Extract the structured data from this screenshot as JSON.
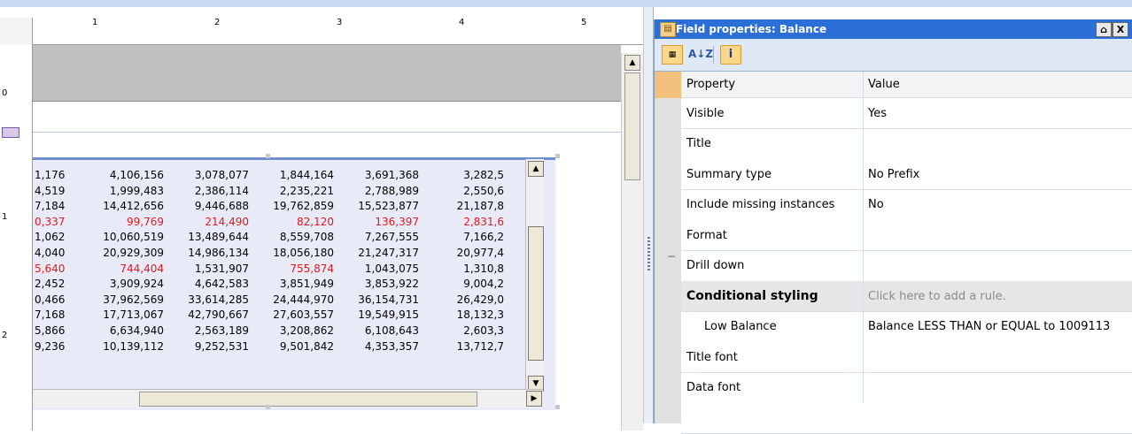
{
  "ruler": {
    "top_marks": [
      "1",
      "2",
      "3",
      "4",
      "5"
    ],
    "left_marks": [
      "0",
      "1",
      "2"
    ]
  },
  "grid": {
    "rows": [
      {
        "cells": [
          "1,176",
          "4,106,156",
          "3,078,077",
          "1,844,164",
          "3,691,368",
          "3,282,5"
        ],
        "red": false
      },
      {
        "cells": [
          "4,519",
          "1,999,483",
          "2,386,114",
          "2,235,221",
          "2,788,989",
          "2,550,6"
        ],
        "red": false
      },
      {
        "cells": [
          "7,184",
          "14,412,656",
          "9,446,688",
          "19,762,859",
          "15,523,877",
          "21,187,8"
        ],
        "red": false
      },
      {
        "cells": [
          "0,337",
          "99,769",
          "214,490",
          "82,120",
          "136,397",
          "2,831,6"
        ],
        "red": true
      },
      {
        "cells": [
          "1,062",
          "10,060,519",
          "13,489,644",
          "8,559,708",
          "7,267,555",
          "7,166,2"
        ],
        "red": false
      },
      {
        "cells": [
          "4,040",
          "20,929,309",
          "14,986,134",
          "18,056,180",
          "21,247,317",
          "20,977,4"
        ],
        "red": false
      },
      {
        "cells": [
          "5,640",
          "744,404",
          "1,531,907",
          "755,874",
          "1,043,075",
          "1,310,8"
        ],
        "red": true,
        "red_cols": [
          0,
          1,
          3
        ]
      },
      {
        "cells": [
          "2,452",
          "3,909,924",
          "4,642,583",
          "3,851,949",
          "3,853,922",
          "9,004,2"
        ],
        "red": false
      },
      {
        "cells": [
          "0,466",
          "37,962,569",
          "33,614,285",
          "24,444,970",
          "36,154,731",
          "26,429,0"
        ],
        "red": false
      },
      {
        "cells": [
          "7,168",
          "17,713,067",
          "42,790,667",
          "27,603,557",
          "19,549,915",
          "18,132,3"
        ],
        "red": false
      },
      {
        "cells": [
          "5,866",
          "6,634,940",
          "2,563,189",
          "3,208,862",
          "6,108,643",
          "2,603,3"
        ],
        "red": false
      },
      {
        "cells": [
          "9,236",
          "10,139,112",
          "9,252,531",
          "9,501,842",
          "4,353,357",
          "13,712,7"
        ],
        "red": false
      }
    ]
  },
  "panel": {
    "title": "Field properties: Balance",
    "pin_label": "⌂",
    "close_label": "X",
    "toolbar": {
      "categorized_icon": "categorized-icon",
      "sort_icon": "sort-az-icon",
      "sort_label": "A↓Z",
      "info_icon": "property-pages-icon",
      "info_label": "i"
    },
    "header": {
      "property": "Property",
      "value": "Value"
    },
    "rows": [
      {
        "name": "Visible",
        "value": "Yes"
      },
      {
        "name": "Title",
        "value": ""
      },
      {
        "name": "Summary type",
        "value": "No Prefix"
      },
      {
        "name": "Include missing instances",
        "value": "No"
      },
      {
        "name": "Format",
        "value": ""
      },
      {
        "name": "Drill down",
        "value": ""
      },
      {
        "name": "Conditional styling",
        "value": "Click here to add a rule."
      },
      {
        "name": "Low Balance",
        "value": "Balance LESS THAN or EQUAL to 1009113"
      },
      {
        "name": "Title font",
        "value": ""
      },
      {
        "name": "Data font",
        "value": ""
      }
    ],
    "collapse_symbol": "−"
  },
  "colors": {
    "accent": "#2c6fd6",
    "negative": "#e0191c",
    "toolbar_bg": "#dfe8f5",
    "gutter": "#f3c17c"
  }
}
